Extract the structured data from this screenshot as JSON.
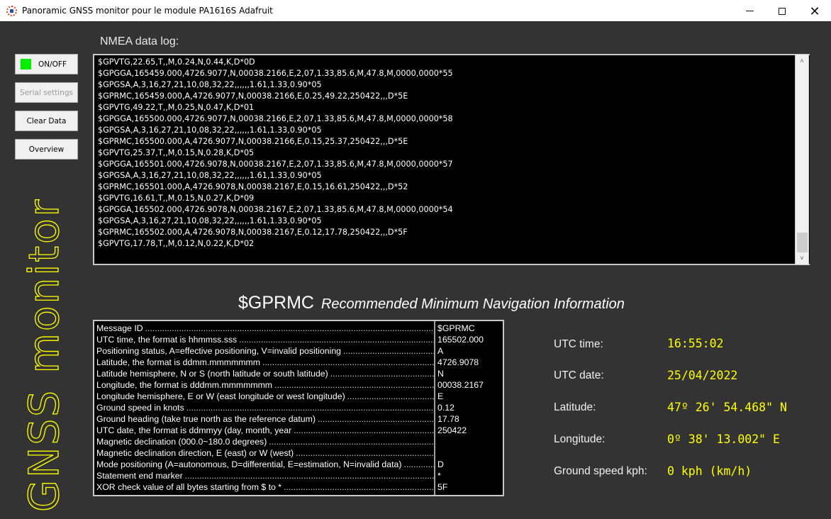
{
  "window": {
    "title": "Panoramic GNSS monitor pour le module PA1616S Adafruit",
    "minimize_icon": "minimize-icon",
    "maximize_icon": "maximize-icon",
    "close_icon": "close-icon",
    "close_glyph": "✕"
  },
  "sidebar": {
    "buttons": [
      {
        "label": "ON/OFF",
        "indicator_color": "#00ee00",
        "enabled": true
      },
      {
        "label": "Serial settings",
        "enabled": false
      },
      {
        "label": "Clear Data",
        "enabled": true
      },
      {
        "label": "Overview",
        "enabled": true
      }
    ],
    "vertical_title": "GNSS monitor",
    "vertical_title_color": "#ffff00"
  },
  "log": {
    "label": "NMEA data log:",
    "lines": [
      "$GPVTG,22.65,T,,M,0.24,N,0.44,K,D*0D",
      "$GPGGA,165459.000,4726.9077,N,00038.2166,E,2,07,1.33,85.6,M,47.8,M,0000,0000*55",
      "$GPGSA,A,3,16,27,21,10,08,32,22,,,,,,1.61,1.33,0.90*05",
      "$GPRMC,165459.000,A,4726.9077,N,00038.2166,E,0.25,49.22,250422,,,D*5E",
      "$GPVTG,49.22,T,,M,0.25,N,0.47,K,D*01",
      "$GPGGA,165500.000,4726.9077,N,00038.2166,E,2,07,1.33,85.6,M,47.8,M,0000,0000*58",
      "$GPGSA,A,3,16,27,21,10,08,32,22,,,,,,1.61,1.33,0.90*05",
      "$GPRMC,165500.000,A,4726.9077,N,00038.2166,E,0.15,25.37,250422,,,D*5E",
      "$GPVTG,25.37,T,,M,0.15,N,0.28,K,D*05",
      "$GPGGA,165501.000,4726.9078,N,00038.2167,E,2,07,1.33,85.6,M,47.8,M,0000,0000*57",
      "$GPGSA,A,3,16,27,21,10,08,32,22,,,,,,1.61,1.33,0.90*05",
      "$GPRMC,165501.000,A,4726.9078,N,00038.2167,E,0.15,16.61,250422,,,D*52",
      "$GPVTG,16.61,T,,M,0.15,N,0.27,K,D*09",
      "$GPGGA,165502.000,4726.9078,N,00038.2167,E,2,07,1.33,85.6,M,47.8,M,0000,0000*54",
      "$GPGSA,A,3,16,27,21,10,08,32,22,,,,,,1.61,1.33,0.90*05",
      "$GPRMC,165502.000,A,4726.9078,N,00038.2167,E,0.12,17.78,250422,,,D*5F",
      "$GPVTG,17.78,T,,M,0.12,N,0.22,K,D*02"
    ],
    "scroll_up_glyph": "˄",
    "scroll_down_glyph": "˅"
  },
  "message": {
    "id": "$GPRMC",
    "description": "Recommended Minimum Navigation Information",
    "fields": [
      {
        "label": "Message ID",
        "value": "$GPRMC"
      },
      {
        "label": "UTC time, the format is hhmmss.sss",
        "value": "165502.000"
      },
      {
        "label": "Positioning status, A=effective positioning, V=invalid positioning",
        "value": "A"
      },
      {
        "label": "Latitude, the format is ddmm.mmmmmmm",
        "value": "4726.9078"
      },
      {
        "label": "Latitude hemisphere, N or S (north latitude or south latitude)",
        "value": "N"
      },
      {
        "label": "Longitude, the format is dddmm.mmmmmmm",
        "value": "00038.2167"
      },
      {
        "label": "Longitude hemisphere, E or W (east longitude or west longitude)",
        "value": "E"
      },
      {
        "label": "Ground speed in knots",
        "value": "0.12"
      },
      {
        "label": "Ground heading (take true north as the reference datum)",
        "value": "17.78"
      },
      {
        "label": "UTC date, the format is ddmmyy (day, month, year",
        "value": "250422"
      },
      {
        "label": "Magnetic declination (000.0~180.0 degrees)",
        "value": ""
      },
      {
        "label": "Magnetic declination direction, E (east) or W (west)",
        "value": ""
      },
      {
        "label": "Mode positioning (A=autonomous, D=differential, E=estimation, N=invalid data)",
        "value": "D"
      },
      {
        "label": "Statement end marker",
        "value": "*"
      },
      {
        "label": "XOR check value of all bytes starting from $ to *",
        "value": "5F"
      }
    ]
  },
  "summary": {
    "utc_time": {
      "label": "UTC time:",
      "value": "16:55:02"
    },
    "utc_date": {
      "label": "UTC date:",
      "value": "25/04/2022"
    },
    "latitude": {
      "label": "Latitude:",
      "value": "47º 26' 54.468\" N"
    },
    "longitude": {
      "label": "Longitude:",
      "value": "0º 38' 13.002\" E"
    },
    "ground_speed": {
      "label": "Ground speed kph:",
      "value": "0 kph (km/h)"
    },
    "value_color": "#ffff00"
  }
}
